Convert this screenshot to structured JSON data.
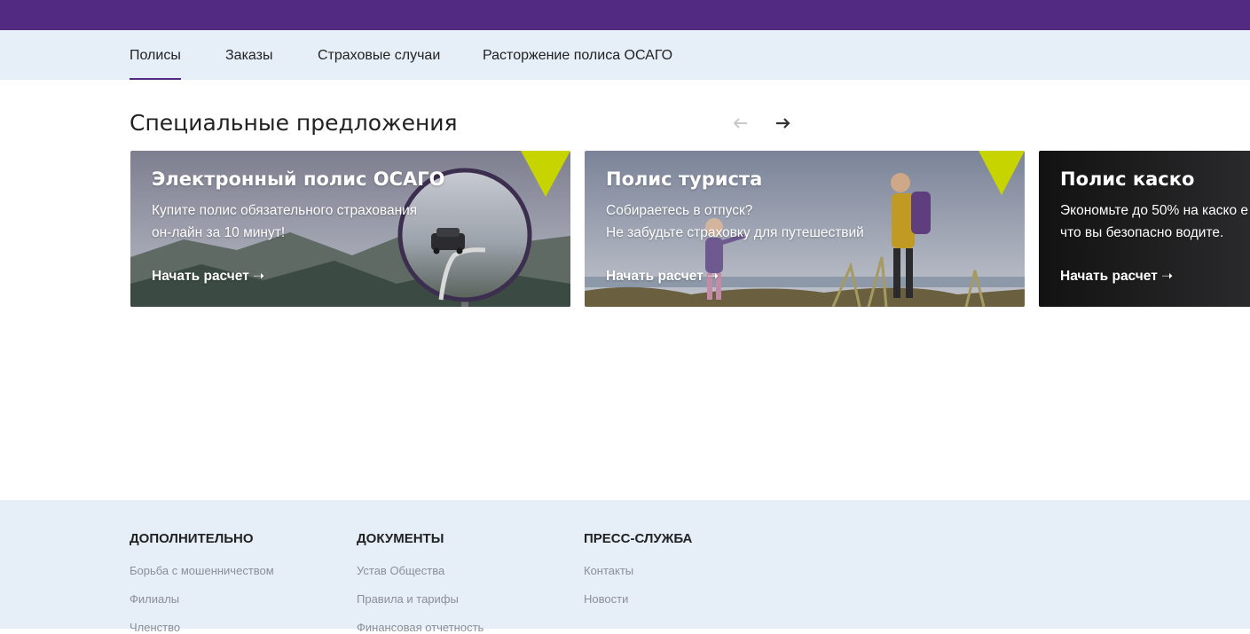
{
  "colors": {
    "brand": "#522a82",
    "light_bg": "#e6eef8",
    "badge": "#c8d400"
  },
  "tabs": [
    "Полисы",
    "Заказы",
    "Страховые случаи",
    "Расторжение полиса ОСАГО"
  ],
  "offers": {
    "title": "Специальные предложения",
    "prev_icon": "arrow-left-icon",
    "next_icon": "arrow-right-icon",
    "cards": [
      {
        "title": "Электронный полис ОСАГО",
        "line1": "Купите полис обязательного страхования",
        "line2": "он-лайн за 10 минут!",
        "cta": "Начать расчет ➝"
      },
      {
        "title": "Полис туриста",
        "line1": "Собираетесь в отпуск?",
        "line2": "Не забудьте страховку для путешествий",
        "cta": "Начать расчет ➝"
      },
      {
        "title": "Полис каско",
        "line1": "Экономьте до 50% на каско е",
        "line2": "что вы безопасно водите.",
        "cta": "Начать расчет ➝"
      }
    ]
  },
  "footer": {
    "columns": [
      {
        "heading": "ДОПОЛНИТЕЛЬНО",
        "links": [
          "Борьба с мошенничеством",
          "Филиалы",
          "Членство"
        ]
      },
      {
        "heading": "ДОКУМЕНТЫ",
        "links": [
          "Устав Общества",
          "Правила и тарифы",
          "Финансовая отчетность"
        ]
      },
      {
        "heading": "ПРЕСС-СЛУЖБА",
        "links": [
          "Контакты",
          "Новости"
        ]
      }
    ]
  }
}
